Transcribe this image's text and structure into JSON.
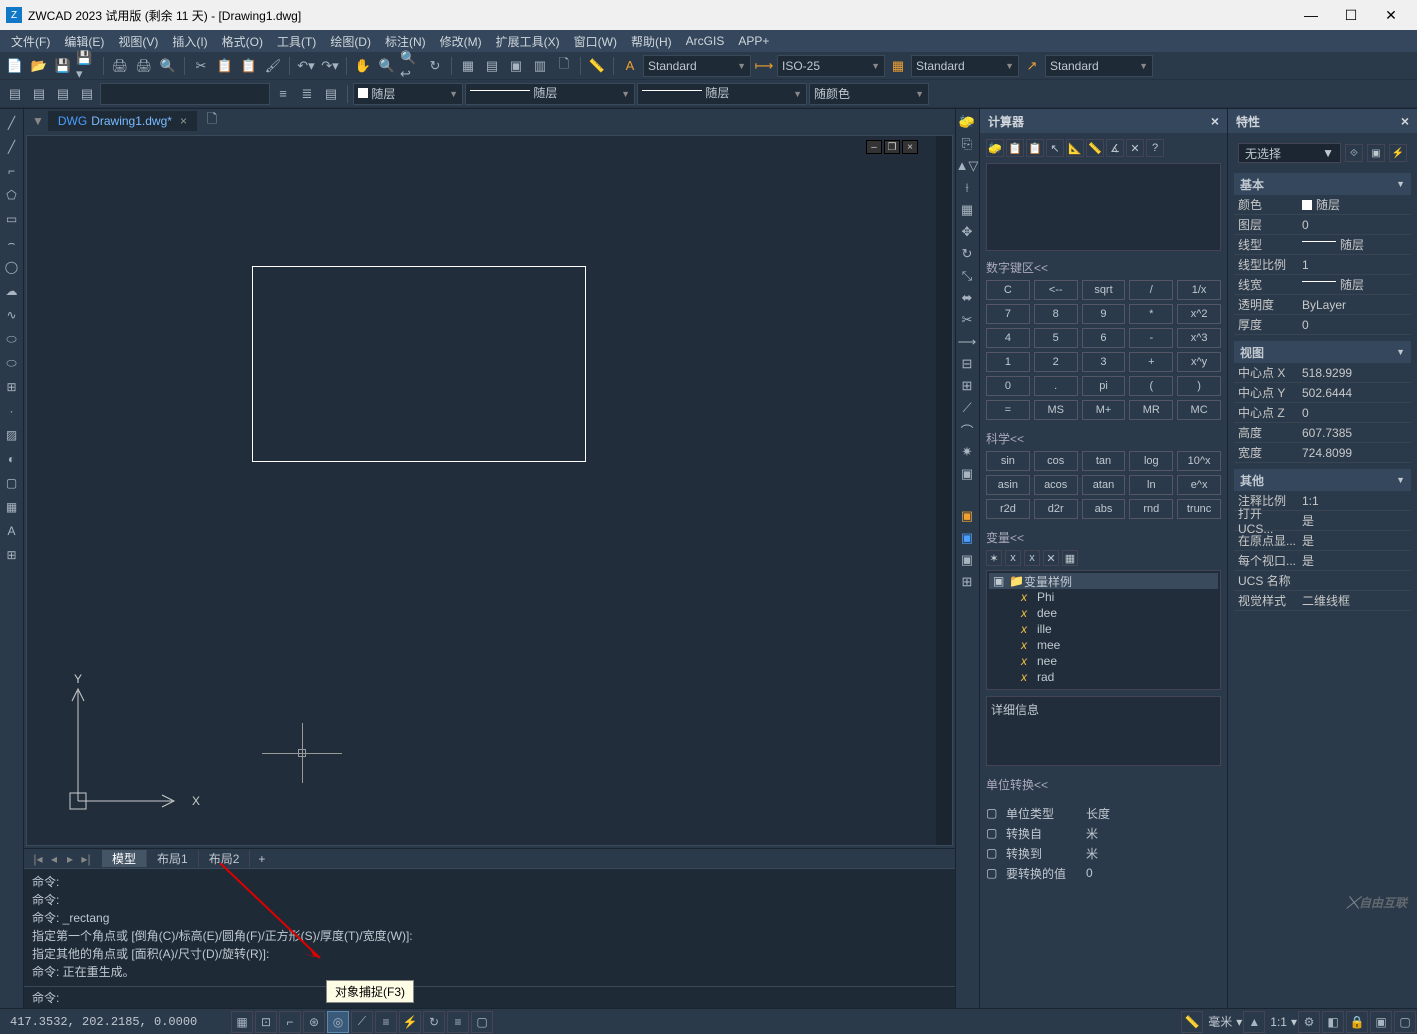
{
  "title": "ZWCAD 2023 试用版 (剩余 11 天) - [Drawing1.dwg]",
  "menu": [
    "文件(F)",
    "编辑(E)",
    "视图(V)",
    "插入(I)",
    "格式(O)",
    "工具(T)",
    "绘图(D)",
    "标注(N)",
    "修改(M)",
    "扩展工具(X)",
    "窗口(W)",
    "帮助(H)",
    "ArcGIS",
    "APP+"
  ],
  "styles": {
    "text": "Standard",
    "dim": "ISO-25",
    "table": "Standard",
    "mleader": "Standard"
  },
  "layer_row": {
    "layer": "随层",
    "linetype": "随层",
    "lineweight": "随层",
    "color": "随颜色"
  },
  "doc_tab": "Drawing1.dwg*",
  "layout_tabs": {
    "active": "模型",
    "tabs": [
      "模型",
      "布局1",
      "布局2"
    ]
  },
  "cmd_history": [
    "命令:",
    "命令:",
    "命令: _rectang",
    "指定第一个角点或 [倒角(C)/标高(E)/圆角(F)/正方形(S)/厚度(T)/宽度(W)]:",
    "指定其他的角点或 [面积(A)/尺寸(D)/旋转(R)]:",
    "命令: 正在重生成。"
  ],
  "cmd_prompt": "命令:",
  "calc": {
    "title": "计算器",
    "numpad_head": "数字键区<<",
    "keys": [
      [
        "C",
        "<--",
        "sqrt",
        "/",
        "1/x"
      ],
      [
        "7",
        "8",
        "9",
        "*",
        "x^2"
      ],
      [
        "4",
        "5",
        "6",
        "-",
        "x^3"
      ],
      [
        "1",
        "2",
        "3",
        "+",
        "x^y"
      ],
      [
        "0",
        ".",
        "pi",
        "(",
        ")"
      ],
      [
        "=",
        "MS",
        "M+",
        "MR",
        "MC"
      ]
    ],
    "sci_head": "科学<<",
    "sci": [
      [
        "sin",
        "cos",
        "tan",
        "log",
        "10^x"
      ],
      [
        "asin",
        "acos",
        "atan",
        "ln",
        "e^x"
      ],
      [
        "r2d",
        "d2r",
        "abs",
        "rnd",
        "trunc"
      ]
    ],
    "var_head": "变量<<",
    "var_root": "变量样例",
    "vars": [
      "Phi",
      "dee",
      "ille",
      "mee",
      "nee",
      "rad"
    ],
    "detail": "详细信息",
    "unit_head": "单位转换<<",
    "unit_rows": [
      {
        "k": "单位类型",
        "v": "长度"
      },
      {
        "k": "转换自",
        "v": "米"
      },
      {
        "k": "转换到",
        "v": "米"
      },
      {
        "k": "要转换的值",
        "v": "0"
      }
    ]
  },
  "prop": {
    "title": "特性",
    "sel": "无选择",
    "sections": [
      {
        "head": "基本",
        "rows": [
          {
            "k": "颜色",
            "v": "随层",
            "sw": true
          },
          {
            "k": "图层",
            "v": "0"
          },
          {
            "k": "线型",
            "v": "随层",
            "line": true
          },
          {
            "k": "线型比例",
            "v": "1"
          },
          {
            "k": "线宽",
            "v": "随层",
            "line": true
          },
          {
            "k": "透明度",
            "v": "ByLayer"
          },
          {
            "k": "厚度",
            "v": "0"
          }
        ]
      },
      {
        "head": "视图",
        "rows": [
          {
            "k": "中心点 X",
            "v": "518.9299"
          },
          {
            "k": "中心点 Y",
            "v": "502.6444"
          },
          {
            "k": "中心点 Z",
            "v": "0"
          },
          {
            "k": "高度",
            "v": "607.7385"
          },
          {
            "k": "宽度",
            "v": "724.8099"
          }
        ]
      },
      {
        "head": "其他",
        "rows": [
          {
            "k": "注释比例",
            "v": "1:1"
          },
          {
            "k": "打开 UCS...",
            "v": "是"
          },
          {
            "k": "在原点显...",
            "v": "是"
          },
          {
            "k": "每个视口...",
            "v": "是"
          },
          {
            "k": "UCS 名称",
            "v": ""
          },
          {
            "k": "视觉样式",
            "v": "二维线框"
          }
        ]
      }
    ]
  },
  "status": {
    "coords": "417.3532, 202.2185, 0.0000",
    "tooltip": "对象捕捉(F3)",
    "right": [
      "毫米",
      "1:1"
    ]
  },
  "watermark": "自由互联",
  "ucs": {
    "x": "X",
    "y": "Y"
  }
}
